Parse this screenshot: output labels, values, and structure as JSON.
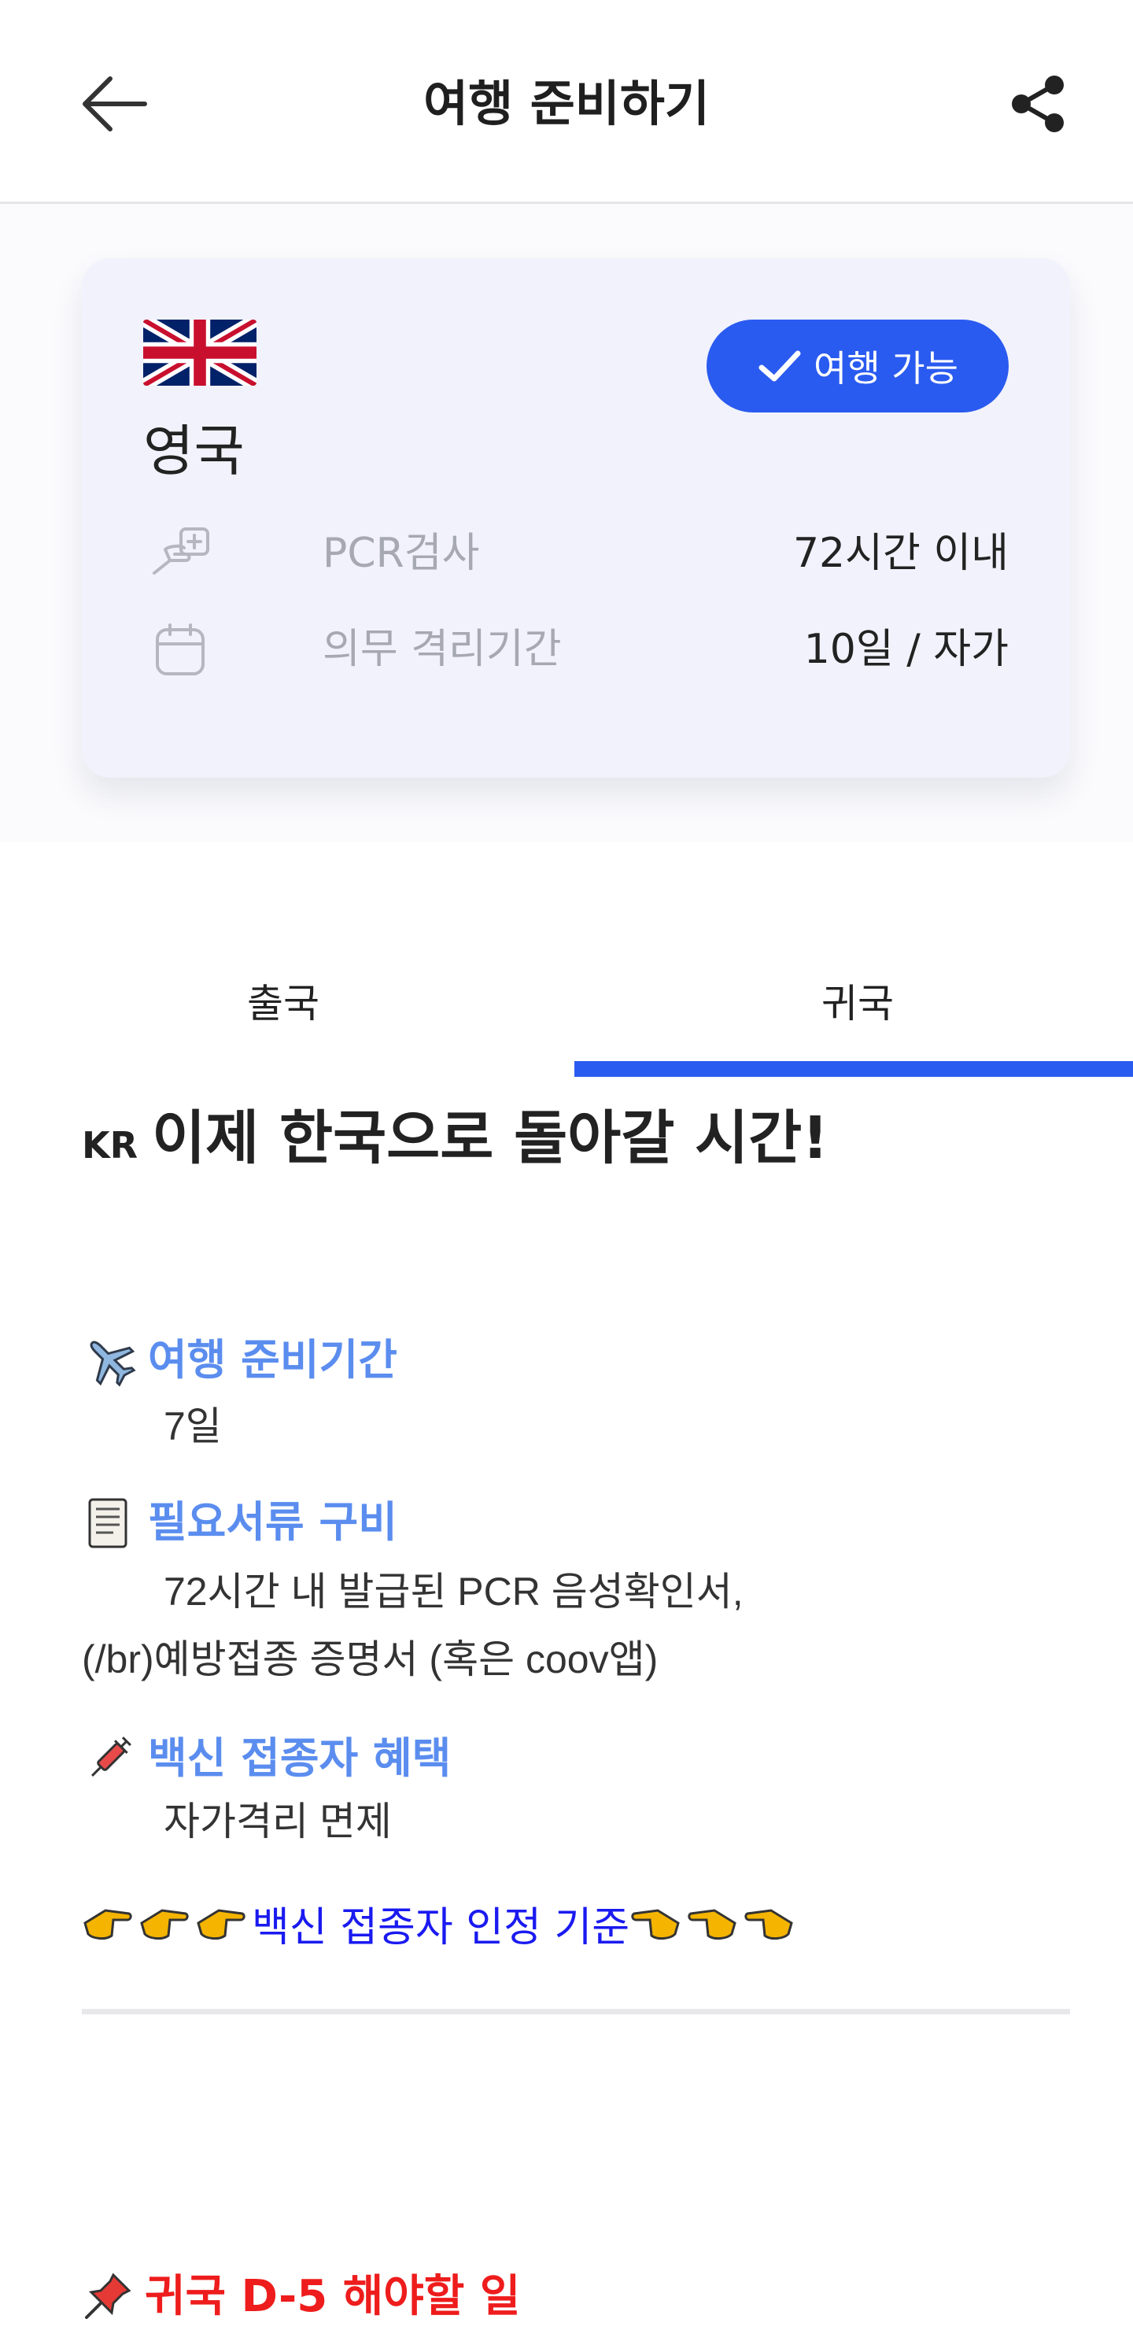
{
  "header": {
    "title": "여행 준비하기",
    "back_icon": "arrow-left-icon",
    "share_icon": "share-icon"
  },
  "summary": {
    "country": "영국",
    "flag": "united-kingdom-flag",
    "status": "여행 가능",
    "rows": [
      {
        "icon": "test-hand-icon",
        "label": "PCR검사",
        "value": "72시간 이내"
      },
      {
        "icon": "calendar-icon",
        "label": "의무 격리기간",
        "value": "10일 / 자가"
      }
    ]
  },
  "tabs": [
    {
      "label": "출국",
      "active": false
    },
    {
      "label": "귀국",
      "active": true
    }
  ],
  "content": {
    "headline_prefix": "KR",
    "headline": "이제 한국으로 돌아갈 시간!",
    "sections": [
      {
        "icon": "airplane-icon",
        "title": "여행 준비기간",
        "body": [
          "7일"
        ]
      },
      {
        "icon": "document-icon",
        "title": "필요서류 구비",
        "body": [
          "72시간 내 발급된 PCR 음성확인서,",
          "(/br)예방접종 증명서 (혹은 coov앱)"
        ]
      },
      {
        "icon": "syringe-icon",
        "title": "백신 접종자 혜택",
        "body": [
          "자가격리 면제"
        ]
      }
    ],
    "link_text": "백신 접종자 인정 기준",
    "todo_title": "귀국 D-5 해야할 일"
  },
  "colors": {
    "accent": "#2a5bf0",
    "section_title": "#5b8def",
    "link": "#1a1af0",
    "todo": "#ee1c1c",
    "card_bg": "#f1f2fb"
  }
}
